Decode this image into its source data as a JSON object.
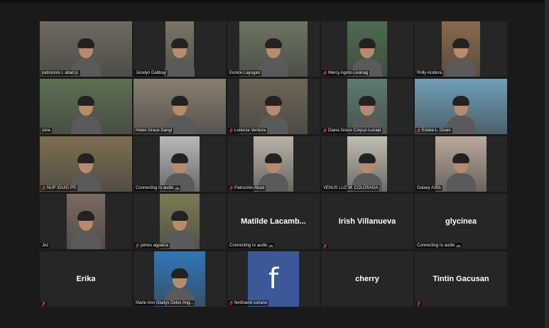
{
  "colors": {
    "active_border": "#c9d44a",
    "muted_icon": "#e0413a",
    "facebook_blue": "#3b5998"
  },
  "tiles": [
    {
      "label": "patrocinio l. abad jr.",
      "muted": false,
      "kind": "video",
      "bg": "#6e6a5e",
      "width": 130
    },
    {
      "label": "Jocelyn Dabbay",
      "muted": false,
      "kind": "video",
      "bg": "#7a7564",
      "width": 40
    },
    {
      "label": "Eunice Layugan",
      "muted": false,
      "kind": "video",
      "bg": "#6b7560",
      "width": 96
    },
    {
      "label": "Mercy Agoto-Livanag",
      "muted": true,
      "kind": "video",
      "bg": "#4d6b4e",
      "width": 56
    },
    {
      "label": "Rolly Acidera",
      "muted": false,
      "kind": "video",
      "bg": "#8a6a4a",
      "width": 54
    },
    {
      "label": "zora",
      "muted": false,
      "kind": "video",
      "bg": "#5c7052",
      "width": 130,
      "active": true
    },
    {
      "label": "Helen Grace Dangi",
      "muted": false,
      "kind": "video",
      "bg": "#8a7f70",
      "width": 130
    },
    {
      "label": "Lorenze Ventura",
      "muted": true,
      "kind": "video",
      "bg": "#6e6656",
      "width": 96
    },
    {
      "label": "Diana Grace Corpuz-Lucapi",
      "muted": true,
      "kind": "video",
      "bg": "#5d7b72",
      "width": 56
    },
    {
      "label": "Estela L. Dirain",
      "muted": true,
      "kind": "video",
      "bg": "#6f9fb8",
      "width": 130
    },
    {
      "label": "NUP IGUIG PS",
      "muted": true,
      "kind": "video",
      "bg": "#7c6e52",
      "width": 130
    },
    {
      "label": "Connecting to audio",
      "muted": false,
      "kind": "video",
      "bg": "#b8b8b8",
      "width": 56,
      "connecting": true
    },
    {
      "label": "Patrocinio Abad",
      "muted": true,
      "kind": "video",
      "bg": "#b9b2a6",
      "width": 56
    },
    {
      "label": "VENUS LUZ M. COLOSAGA",
      "muted": false,
      "kind": "video",
      "bg": "#c4bdb0",
      "width": 56
    },
    {
      "label": "Galaxy A30s",
      "muted": false,
      "kind": "video",
      "bg": "#b9a99a",
      "width": 72
    },
    {
      "label": "Jez",
      "muted": false,
      "kind": "video",
      "bg": "#7b6a60",
      "width": 54
    },
    {
      "label": "james agpalza",
      "muted": true,
      "kind": "video",
      "bg": "#7c7a55",
      "width": 56
    },
    {
      "label": "Connecting to audio",
      "muted": false,
      "kind": "name",
      "name": "Matilde  Lacamb...",
      "connecting": true
    },
    {
      "label": "",
      "muted": true,
      "kind": "name",
      "name": "Irish Villanueva"
    },
    {
      "label": "Connecting to audio",
      "muted": false,
      "kind": "name",
      "name": "glycinea",
      "connecting": true
    },
    {
      "label": "",
      "muted": true,
      "kind": "name",
      "name": "Erika"
    },
    {
      "label": "Marie Ann Gladys Delos Ang...",
      "muted": false,
      "kind": "video",
      "bg": "#2f77b8",
      "width": 72
    },
    {
      "label": "ferdinand soriano",
      "muted": true,
      "kind": "facebook",
      "glyph": "f"
    },
    {
      "label": "",
      "muted": false,
      "kind": "name",
      "name": "cherry"
    },
    {
      "label": "",
      "muted": true,
      "kind": "name",
      "name": "Tintin Gacusan"
    }
  ]
}
